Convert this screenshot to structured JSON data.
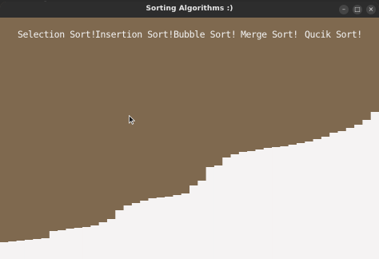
{
  "window": {
    "title": "Sorting Algorithms :)",
    "background_color": "#7f694f",
    "bar_color": "#f5f3f3"
  },
  "controls": {
    "minimize": "–",
    "maximize": "□",
    "close": "×"
  },
  "menu": [
    {
      "label": "Selection Sort!"
    },
    {
      "label": "Insertion Sort!"
    },
    {
      "label": "Bubble Sort!"
    },
    {
      "label": "Merge Sort!"
    },
    {
      "label": "Qucik Sort!"
    }
  ],
  "bar_values": [
    21,
    22,
    23,
    24,
    25,
    26,
    35,
    36,
    38,
    39,
    40,
    42,
    46,
    50,
    61,
    67,
    70,
    73,
    76,
    77,
    78,
    80,
    82,
    92,
    98,
    115,
    117,
    127,
    131,
    134,
    135,
    137,
    139,
    140,
    141,
    143,
    145,
    147,
    150,
    153,
    158,
    160,
    164,
    168,
    174,
    184
  ]
}
